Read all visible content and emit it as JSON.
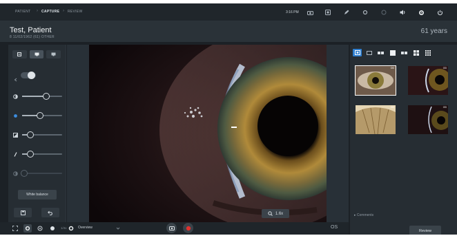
{
  "breadcrumb": {
    "items": [
      "PATIENT",
      "CAPTURE",
      "REVIEW"
    ],
    "separator": "›"
  },
  "topbar": {
    "time": "3:16 PM",
    "icons": [
      "camera-icon",
      "device-icon",
      "pen-icon",
      "settings-icon",
      "light-icon",
      "volume-icon",
      "gear-icon",
      "power-icon"
    ]
  },
  "patient": {
    "name": "Test, Patient",
    "meta": "8   11/02/1962 (61)   OTHER",
    "age": "61 years"
  },
  "left_panel": {
    "mode_icons": [
      "minus-icon",
      "monitor-icon",
      "monitor-alt-icon"
    ],
    "toggle_on": true,
    "sliders": [
      {
        "icon": "brightness-icon",
        "level": 0.6
      },
      {
        "icon": "diffuser-icon",
        "level": 0.45
      },
      {
        "icon": "filter-icon",
        "level": 0.2
      },
      {
        "icon": "slit-icon",
        "level": 0.2
      },
      {
        "icon": "contrast-icon",
        "level": 0.05
      }
    ],
    "white_balance_label": "White balance",
    "bottom_icons": [
      "save-icon",
      "undo-icon"
    ]
  },
  "viewer": {
    "zoom_label": "1.6x"
  },
  "right_panel": {
    "view_toggles": [
      "thumbnail-view-icon",
      "strip-view-icon",
      "dual-view-icon",
      "single-view-icon",
      "two-up-icon",
      "four-up-icon",
      "grid-view-icon"
    ],
    "active_toggle": 0,
    "thumbnails": [
      {
        "badge": "OD",
        "selected": true
      },
      {
        "badge": "OD",
        "selected": false
      },
      {
        "badge": "OD",
        "selected": false
      },
      {
        "badge": "OD",
        "selected": false
      }
    ],
    "comments_label": "Comments",
    "review_label": "Review"
  },
  "bottombar": {
    "ratio": "1/4x",
    "preset": "Overview",
    "eye": "OS"
  },
  "colors": {
    "accent": "#2f7fd0",
    "record": "#e0322e",
    "background": "#1c2126"
  }
}
